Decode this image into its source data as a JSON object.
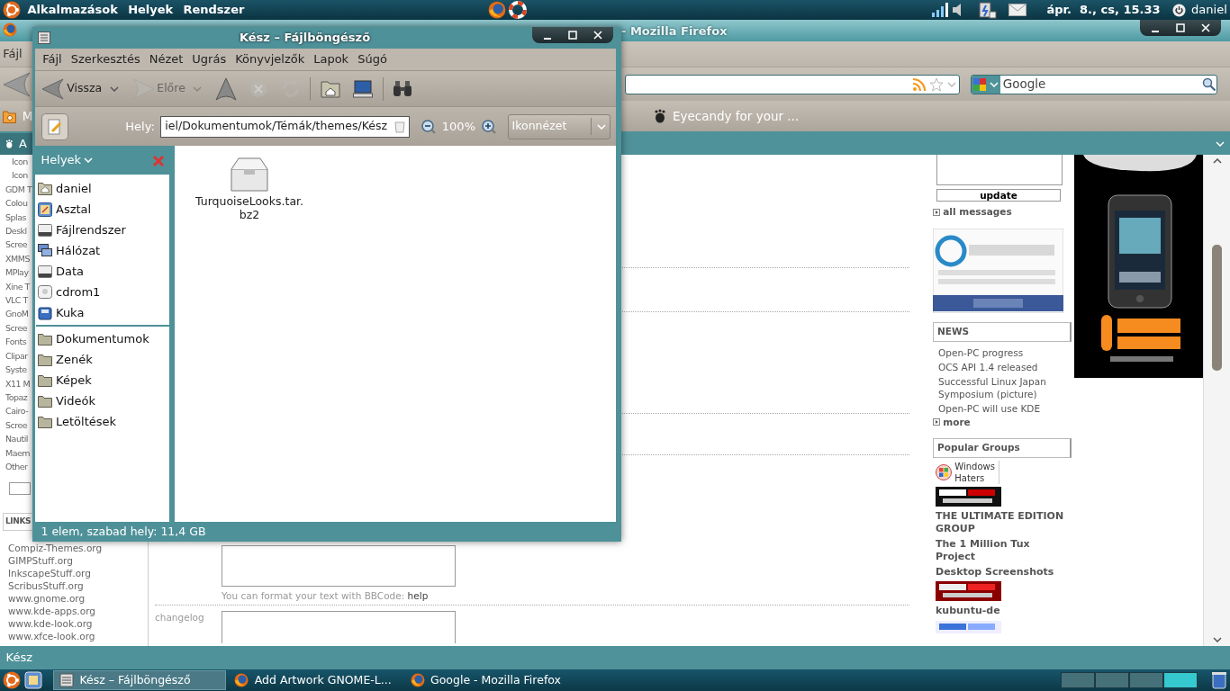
{
  "top_panel": {
    "menus": [
      "Alkalmazások",
      "Helyek",
      "Rendszer"
    ],
    "clock": "ápr.  8., cs, 15.33",
    "user": "daniel"
  },
  "firefox": {
    "title": "- Mozilla Firefox",
    "menus": [
      "Fájl"
    ],
    "search": {
      "value": "Google"
    },
    "bookmarks": [
      {
        "kind": "folder",
        "label": "M"
      },
      {
        "kind": "foot",
        "label": "Eyecandy for your ..."
      }
    ],
    "tabs": [
      {
        "label": "A",
        "selected": true
      }
    ],
    "sidebar": {
      "items": [
        "Icon",
        "Icon",
        "GDM T",
        "Colou",
        "Splas",
        "Deskl",
        "Scree",
        "XMMS",
        "MPlay",
        "Xine T",
        "VLC T",
        "GnoM",
        "Scree",
        "Fonts",
        "Clipar",
        "Syste",
        "X11 M",
        "Topaz",
        "Cairo-",
        "Scree",
        "Nautil",
        "Maem",
        "Other"
      ],
      "links_heading": "LINKS",
      "links": [
        "Compiz-Themes.org",
        "GIMPStuff.org",
        "InkscapeStuff.org",
        "ScribusStuff.org",
        "www.gnome.org",
        "www.kde-apps.org",
        "www.kde-look.org",
        "www.xfce-look.org"
      ]
    },
    "form": {
      "hint": "You can format your text with BBCode:",
      "hint_link": "help",
      "changelog_label": "changelog"
    },
    "right": {
      "update_button": "update",
      "all_messages": "all messages",
      "news_heading": "NEWS",
      "news": [
        "Open-PC progress",
        "OCS API 1.4 released",
        "Successful Linux Japan Symposium (picture)",
        "Open-PC will use KDE"
      ],
      "more": "more",
      "groups_heading": "Popular Groups",
      "groups": [
        {
          "kind": "icon_text",
          "label": "Windows Haters"
        },
        {
          "kind": "banner"
        },
        {
          "kind": "text",
          "label": "THE ULTIMATE EDITION GROUP"
        },
        {
          "kind": "text",
          "label": "The 1 Million Tux Project"
        },
        {
          "kind": "text",
          "label": "Desktop Screenshots"
        },
        {
          "kind": "banner"
        },
        {
          "kind": "text",
          "label": "kubuntu-de"
        },
        {
          "kind": "banner"
        }
      ]
    },
    "status": "Kész"
  },
  "file_browser": {
    "title": "Kész – Fájlböngésző",
    "menus": [
      "Fájl",
      "Szerkesztés",
      "Nézet",
      "Ugrás",
      "Könyvjelzők",
      "Lapok",
      "Súgó"
    ],
    "toolbar": [
      {
        "kind": "back",
        "label": "Vissza",
        "disabled": false
      },
      {
        "kind": "forward",
        "label": "Előre",
        "disabled": true
      },
      {
        "kind": "up",
        "disabled": false
      },
      {
        "kind": "stop",
        "disabled": true
      },
      {
        "kind": "reload",
        "disabled": true
      },
      {
        "kind": "home",
        "disabled": false
      },
      {
        "kind": "computer",
        "disabled": false
      },
      {
        "kind": "search",
        "disabled": false
      }
    ],
    "location": {
      "label": "Hely:",
      "value": "iel/Dokumentumok/Témák/themes/Kész"
    },
    "zoom": "100%",
    "view": "Ikonnézet",
    "sidebar_title": "Helyek",
    "places": [
      {
        "kind": "home",
        "label": "daniel"
      },
      {
        "kind": "desktop",
        "label": "Asztal"
      },
      {
        "kind": "drive",
        "label": "Fájlrendszer"
      },
      {
        "kind": "network",
        "label": "Hálózat"
      },
      {
        "kind": "drive",
        "label": "Data"
      },
      {
        "kind": "cdrom",
        "label": "cdrom1"
      },
      {
        "kind": "trash",
        "label": "Kuka"
      }
    ],
    "bookmarks": [
      "Dokumentumok",
      "Zenék",
      "Képek",
      "Videók",
      "Letöltések"
    ],
    "files": [
      {
        "name": "TurquoiseLooks.tar.bz2"
      }
    ],
    "status": "1 elem, szabad hely: 11,4 GB"
  },
  "taskbar": {
    "tasks": [
      {
        "kind": "files",
        "label": "Kész – Fájlböngésző",
        "selected": true
      },
      {
        "kind": "firefox",
        "label": "Add Artwork GNOME-L...",
        "selected": false
      },
      {
        "kind": "firefox",
        "label": "Google - Mozilla Firefox",
        "selected": false
      }
    ],
    "workspaces": [
      {
        "selected": false
      },
      {
        "selected": false
      },
      {
        "selected": false
      },
      {
        "selected": true
      }
    ]
  }
}
